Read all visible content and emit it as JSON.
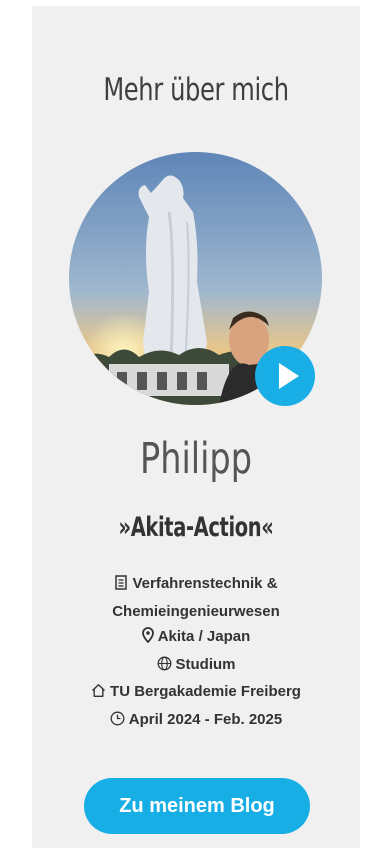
{
  "heading": "Mehr über mich",
  "profile": {
    "name": "Philipp",
    "subtitle": "»Akita-Action«"
  },
  "info": {
    "field_line1": "Verfahrenstechnik &",
    "field_line2": "Chemieingenieurwesen",
    "location": "Akita / Japan",
    "type": "Studium",
    "institution": "TU Bergakademie Freiberg",
    "period": "April 2024 - Feb. 2025"
  },
  "button": {
    "label": "Zu meinem Blog"
  },
  "icons": {
    "field": "document-icon",
    "location": "map-pin-icon",
    "type": "globe-icon",
    "institution": "home-icon",
    "period": "clock-icon",
    "video": "play-icon"
  },
  "colors": {
    "accent": "#17aee6",
    "card_background": "#f0f0f0",
    "text": "#333333"
  }
}
